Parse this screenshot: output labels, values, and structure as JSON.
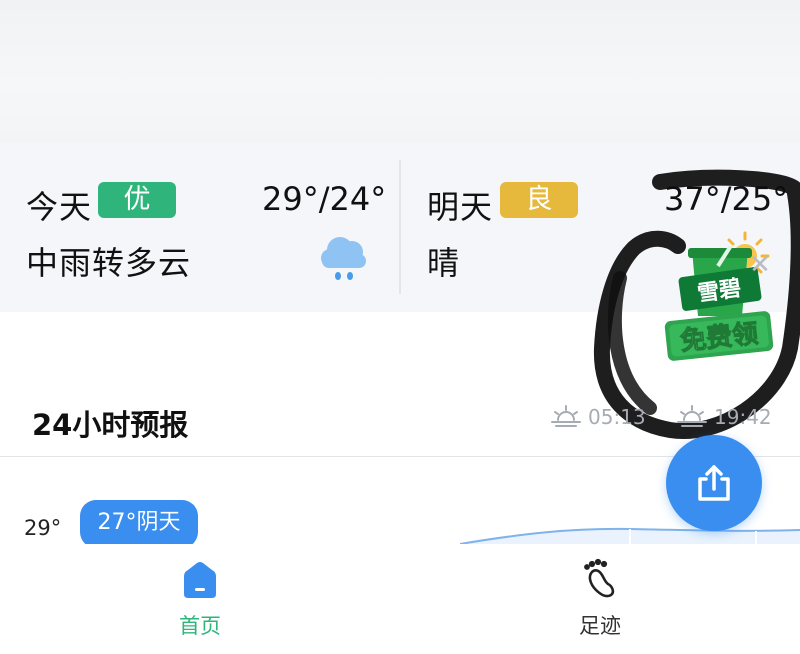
{
  "today": {
    "day_label": "今天",
    "aqi_label": "优",
    "temperature": "29°/24°",
    "condition": "中雨转多云",
    "weather_icon": "cloud-rain-icon",
    "aqi_color": "#2fb57c"
  },
  "tomorrow": {
    "day_label": "明天",
    "aqi_label": "良",
    "temperature": "37°/25°",
    "condition": "晴",
    "weather_icon": "sun-icon",
    "aqi_color": "#e6b83c"
  },
  "ad": {
    "brand": "雪碧",
    "cta": "免费领",
    "close_icon": "close-icon"
  },
  "hourly": {
    "title": "24小时预报",
    "sunrise": "05:13",
    "sunset": "19:42",
    "max_temp": "29°",
    "current_chip": "27°阴天"
  },
  "share": {
    "icon": "share-icon",
    "color": "#3a8ef0"
  },
  "tabbar": {
    "tabs": [
      {
        "label": "首页",
        "icon": "home-icon",
        "active": true
      },
      {
        "label": "足迹",
        "icon": "footprint-icon",
        "active": false
      }
    ],
    "active_color": "#2fb57c"
  }
}
